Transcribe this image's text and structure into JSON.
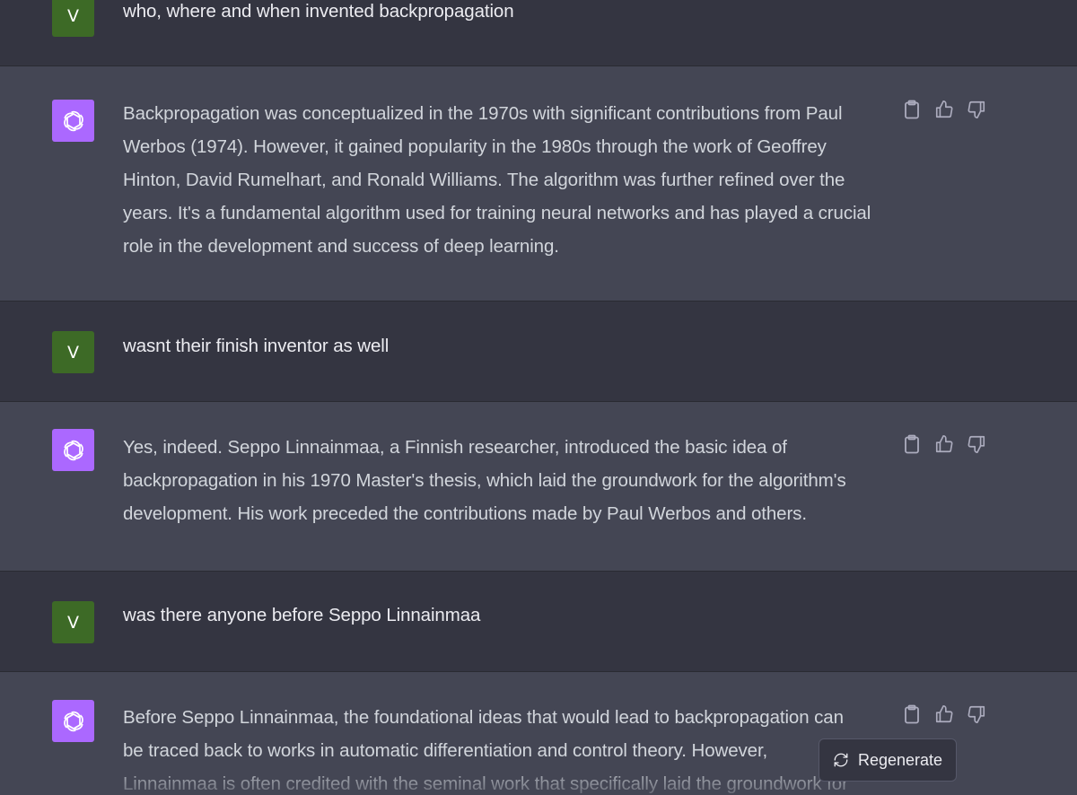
{
  "messages": [
    {
      "role": "user",
      "avatar_letter": "V",
      "text": "who, where and when invented backpropagation"
    },
    {
      "role": "assistant",
      "text": "Backpropagation was conceptualized in the 1970s with significant contributions from Paul\nWerbos (1974). However, it gained popularity in the 1980s through the work of Geoffrey\nHinton, David Rumelhart, and Ronald Williams. The algorithm was further refined over the\nyears. It's a fundamental algorithm used for training neural networks and has played a crucial\nrole in the development and success of deep learning."
    },
    {
      "role": "user",
      "avatar_letter": "V",
      "text": "wasnt their finish inventor as well"
    },
    {
      "role": "assistant",
      "text": "Yes, indeed. Seppo Linnainmaa, a Finnish researcher, introduced the basic idea of\nbackpropagation in his 1970 Master's thesis, which laid the groundwork for the algorithm's\ndevelopment. His work preceded the contributions made by Paul Werbos and others."
    },
    {
      "role": "user",
      "avatar_letter": "V",
      "text": "was there anyone before Seppo Linnainmaa"
    },
    {
      "role": "assistant",
      "text": "Before Seppo Linnainmaa, the foundational ideas that would lead to backpropagation can\nbe traced back to works in automatic differentiation and control theory. However,\nLinnainmaa is often credited with the seminal work that specifically laid the groundwork for"
    }
  ],
  "icons": {
    "bot_avatar": "openai-logo-icon",
    "copy": "clipboard-icon",
    "like": "thumbs-up-icon",
    "dislike": "thumbs-down-icon",
    "regenerate": "refresh-icon"
  },
  "regenerate_label": "Regenerate",
  "colors": {
    "user_bg": "#343541",
    "assistant_bg": "#444654",
    "user_avatar": "#3d6a26",
    "bot_avatar": "#ab68ff"
  }
}
